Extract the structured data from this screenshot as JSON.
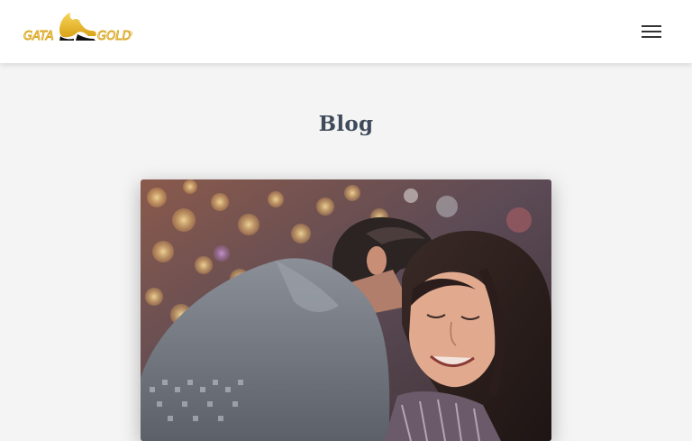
{
  "header": {
    "logo_text": "GATA GOLD",
    "menu_icon": "hamburger-menu-icon"
  },
  "main": {
    "title": "Blog"
  },
  "posts": [
    {
      "image_subject": "couple-hug-photo"
    }
  ],
  "colors": {
    "header_bg": "#ffffff",
    "page_bg": "#f4f4f4",
    "title_color": "#3f4a5a",
    "logo_gold": "#e8b51e",
    "menu_icon": "#333333"
  }
}
